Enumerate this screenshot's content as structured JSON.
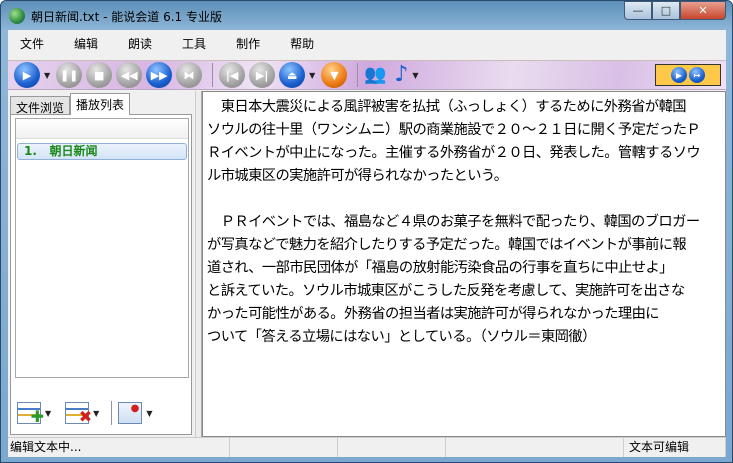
{
  "window": {
    "title": "朝日新闻.txt - 能说会道 6.1 专业版",
    "minimize": "—",
    "maximize": "□",
    "close": "✕"
  },
  "menu": [
    "文件",
    "编辑",
    "朗读",
    "工具",
    "制作",
    "帮助"
  ],
  "toolbar": {
    "icons": [
      "play",
      "pause",
      "stop",
      "rewind",
      "fast-forward",
      "skip",
      "previous",
      "next",
      "eject",
      "down",
      "voices",
      "music"
    ]
  },
  "left_panel": {
    "tabs": [
      "文件浏览",
      "播放列表"
    ],
    "active_tab": 1,
    "items": [
      {
        "index": "1.",
        "name": "朝日新闻"
      }
    ]
  },
  "editor": {
    "lines": [
      "　東日本大震災による風評被害を払拭（ふっしょく）するために外務省が韓国",
      "ソウルの往十里（ワンシムニ）駅の商業施設で２０～２１日に開く予定だったＰ",
      "Ｒイベントが中止になった。主催する外務省が２０日、発表した。管轄するソウ",
      "ル市城東区の実施許可が得られなかったという。",
      "",
      "　ＰＲイベントでは、福島など４県のお菓子を無料で配ったり、韓国のブロガー",
      "が写真などで魅力を紹介したりする予定だった。韓国ではイベントが事前に報",
      "道され、一部市民団体が「福島の放射能汚染食品の行事を直ちに中止せよ」",
      "と訴えていた。ソウル市城東区がこうした反発を考慮して、実施許可を出さな",
      "かった可能性がある。外務省の担当者は実施許可が得られなかった理由に",
      "ついて「答える立場にはない」としている。（ソウル＝東岡徹）"
    ]
  },
  "status": {
    "left": "编辑文本中...",
    "right": "文本可编辑"
  }
}
